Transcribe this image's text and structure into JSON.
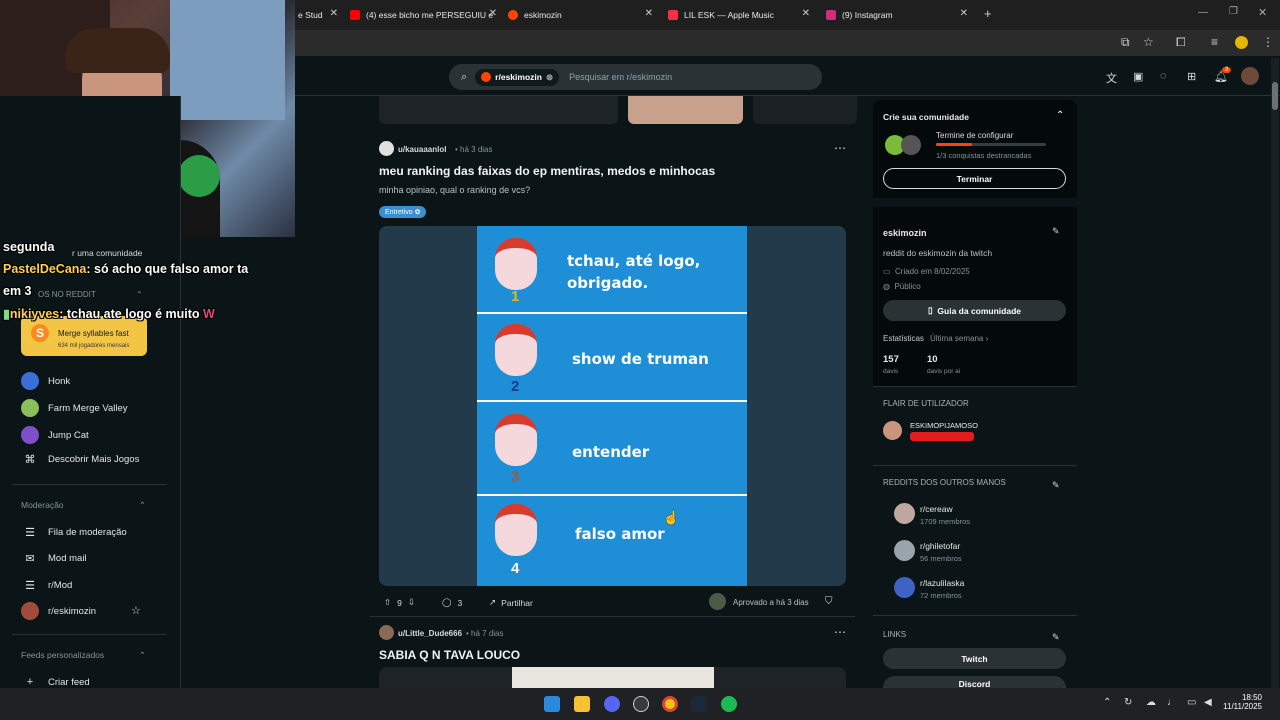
{
  "browser": {
    "tabs": [
      {
        "title": "e Stud",
        "color": "#ffffff"
      },
      {
        "title": "(4) esse bicho me PERSEGUIU e",
        "color": "#ff0000"
      },
      {
        "title": "eskimozin",
        "color": "#ff4500"
      },
      {
        "title": "LIL ESK — Apple Music",
        "color": "#fa2d48"
      },
      {
        "title": "(9) Instagram",
        "color": "#d62976"
      }
    ],
    "new_tab": "+"
  },
  "header": {
    "search_chip": "r/eskimozin",
    "search_placeholder": "Pesquisar em r/eskimozin",
    "notif_count": "3"
  },
  "left_sidebar": {
    "partial_label": "r uma comunidade",
    "section_games": "OS NO REDDIT",
    "featured_game": {
      "name": "Merge syllables fast",
      "sub": "634 mil jogadores mensais"
    },
    "games": [
      "Honk",
      "Farm Merge Valley",
      "Jump Cat",
      "Descobrir Mais Jogos"
    ],
    "section_mod": "Moderação",
    "mod_items": [
      "Fila de moderação",
      "Mod mail",
      "r/Mod",
      "r/eskimozin"
    ],
    "section_feeds": "Feeds personalizados",
    "feed_items": [
      "Criar feed"
    ]
  },
  "posts": [
    {
      "author": "u/kauaaanlol",
      "time": "há 3 dias",
      "title": "meu ranking das faixas do ep mentiras, medos e minhocas",
      "body": "minha opiniao, qual o ranking de vcs?",
      "flair": "Entretivo",
      "image_rows": [
        {
          "rank": "1",
          "text": "tchau, até logo,\nobrigado."
        },
        {
          "rank": "2",
          "text": "show de truman"
        },
        {
          "rank": "3",
          "text": "entender"
        },
        {
          "rank": "4",
          "text": "falso amor"
        }
      ],
      "votes": "9",
      "comments": "3",
      "share": "Partilhar",
      "approved": "Aprovado a há 3 dias"
    },
    {
      "author": "u/Little_Dude666",
      "time": "há 7 dias",
      "title": "SABIA Q N TAVA LOUCO"
    }
  ],
  "right_sidebar": {
    "setup": {
      "title": "Crie sua comunidade",
      "subtitle": "Termine de configurar",
      "progress_text": "1/3 conquistas destrancadas",
      "progress": 0.33,
      "button": "Terminar"
    },
    "about": {
      "name": "eskimozin",
      "description": "reddit do eskimozin da twitch",
      "created": "Criado em 8/02/2025",
      "visibility": "Público",
      "guide_button": "Guia da comunidade",
      "stats_label": "Estatísticas",
      "stats_period": "Última semana",
      "visits": "157",
      "visits_label": "davis",
      "visits_day": "10",
      "visits_day_label": "davis por ai"
    },
    "flair": {
      "title": "FLAIR DE UTILIZADOR",
      "name": "ESKIMOPIJAMOSO"
    },
    "others": {
      "title": "REDDITS DOS OUTROS MANOS",
      "items": [
        {
          "name": "r/cereaw",
          "members": "1709 membros"
        },
        {
          "name": "r/ghiletofar",
          "members": "56 membros"
        },
        {
          "name": "r/lazulilaska",
          "members": "72 membros"
        }
      ]
    },
    "links": {
      "title": "LINKS",
      "items": [
        "Twitch",
        "Discord"
      ]
    }
  },
  "stream_chat": [
    {
      "user": "segunda",
      "msg": ""
    },
    {
      "user": "PastelDeCana",
      "msg": ": só acho que falso amor ta"
    },
    {
      "user": "em 3",
      "msg": ""
    },
    {
      "user": "nikiyves",
      "msg": ": tchau ate logo é muito"
    }
  ],
  "taskbar": {
    "time": "18:50",
    "date": "11/11/2025"
  },
  "colors": {
    "accent": "#ff4500",
    "bg": "#0b1416",
    "image_blue": "#1e8fd6"
  }
}
